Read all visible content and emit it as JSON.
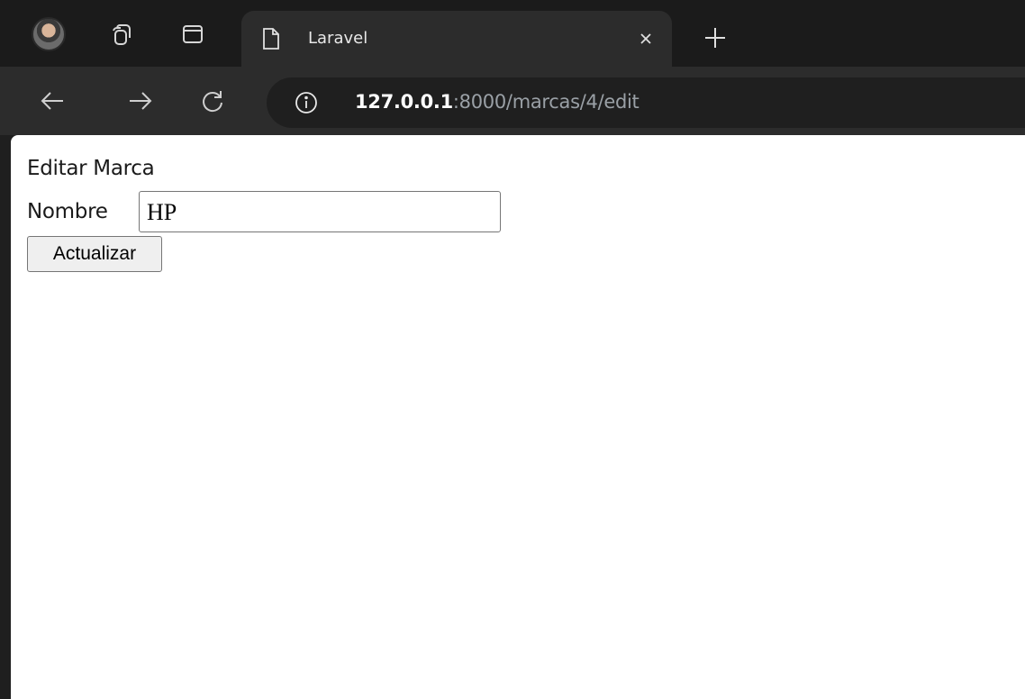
{
  "browser": {
    "tab": {
      "title": "Laravel"
    },
    "address_bar": {
      "host": "127.0.0.1",
      "path": ":8000/marcas/4/edit"
    }
  },
  "page": {
    "heading": "Editar Marca",
    "form": {
      "nombre_label": "Nombre",
      "nombre_value": "HP",
      "submit_label": "Actualizar"
    }
  },
  "colors": {
    "chrome_dark": "#1b1b1b",
    "toolbar": "#2c2c2c",
    "url_host": "#ffffff",
    "url_path": "#9aa0a6",
    "page_background": "#ffffff"
  }
}
